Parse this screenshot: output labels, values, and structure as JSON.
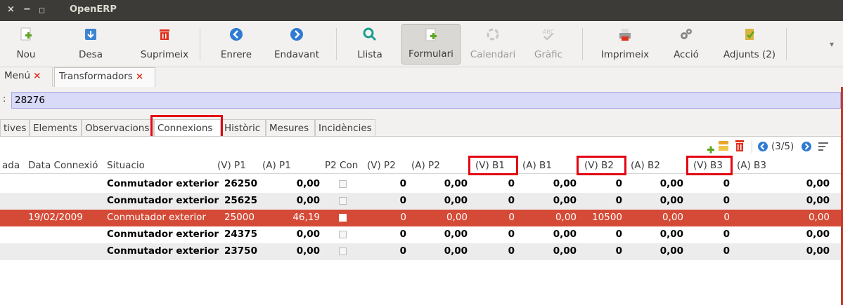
{
  "window": {
    "title": "OpenERP",
    "controls": [
      "×",
      "−",
      "◻"
    ]
  },
  "toolbar": {
    "buttons": [
      {
        "label": "Nou",
        "icon": "new-document-icon",
        "enabled": true
      },
      {
        "label": "Desa",
        "icon": "save-icon",
        "enabled": true
      },
      {
        "label": "Suprimeix",
        "icon": "trash-icon",
        "enabled": true
      },
      {
        "label": "Enrere",
        "icon": "arrow-left-icon",
        "enabled": true
      },
      {
        "label": "Endavant",
        "icon": "arrow-right-icon",
        "enabled": true
      },
      {
        "label": "Llista",
        "icon": "search-icon",
        "enabled": true
      },
      {
        "label": "Formulari",
        "icon": "form-icon",
        "enabled": true,
        "active": true
      },
      {
        "label": "Calendari",
        "icon": "calendar-icon",
        "enabled": false
      },
      {
        "label": "Gràfic",
        "icon": "graph-icon",
        "enabled": false
      },
      {
        "label": "Imprimeix",
        "icon": "print-icon",
        "enabled": true
      },
      {
        "label": "Acció",
        "icon": "gears-icon",
        "enabled": true
      },
      {
        "label": "Adjunts (2)",
        "icon": "attachment-icon",
        "enabled": true
      }
    ],
    "overflow": "▾"
  },
  "doc_tabs": [
    {
      "label": "Menú",
      "close": "×"
    },
    {
      "label": "Transformadors",
      "close": "×",
      "active": true
    }
  ],
  "record": {
    "colon": ":",
    "id_value": "28276"
  },
  "form_tabs": [
    {
      "label": "tives"
    },
    {
      "label": "Elements"
    },
    {
      "label": "Observacions"
    },
    {
      "label": "Connexions",
      "active": true
    },
    {
      "label": "Històric"
    },
    {
      "label": "Mesures"
    },
    {
      "label": "Incidències"
    }
  ],
  "list": {
    "pager": "(3/5)",
    "columns": [
      "ada",
      "Data Connexió",
      "Situacio",
      "(V) P1",
      "(A) P1",
      "P2 Con",
      "(V) P2",
      "(A) P2",
      "(V) B1",
      "(A) B1",
      "(V) B2",
      "(A) B2",
      "(V) B3",
      "(A) B3"
    ],
    "rows": [
      {
        "date": "",
        "situacio": "Conmutador exterior",
        "v_p1": "26250",
        "a_p1": "0,00",
        "p2con": false,
        "v_p2": "0",
        "a_p2": "0,00",
        "v_b1": "0",
        "a_b1": "0,00",
        "v_b2": "0",
        "a_b2": "0,00",
        "v_b3": "0",
        "a_b3": "0,00"
      },
      {
        "date": "",
        "situacio": "Conmutador exterior",
        "v_p1": "25625",
        "a_p1": "0,00",
        "p2con": false,
        "v_p2": "0",
        "a_p2": "0,00",
        "v_b1": "0",
        "a_b1": "0,00",
        "v_b2": "0",
        "a_b2": "0,00",
        "v_b3": "0",
        "a_b3": "0,00"
      },
      {
        "date": "19/02/2009",
        "situacio": "Conmutador exterior",
        "v_p1": "25000",
        "a_p1": "46,19",
        "p2con": true,
        "v_p2": "0",
        "a_p2": "0,00",
        "v_b1": "0",
        "a_b1": "0,00",
        "v_b2": "10500",
        "a_b2": "0,00",
        "v_b3": "0",
        "a_b3": "0,00",
        "selected": true
      },
      {
        "date": "",
        "situacio": "Conmutador exterior",
        "v_p1": "24375",
        "a_p1": "0,00",
        "p2con": false,
        "v_p2": "0",
        "a_p2": "0,00",
        "v_b1": "0",
        "a_b1": "0,00",
        "v_b2": "0",
        "a_b2": "0,00",
        "v_b3": "0",
        "a_b3": "0,00"
      },
      {
        "date": "",
        "situacio": "Conmutador exterior",
        "v_p1": "23750",
        "a_p1": "0,00",
        "p2con": false,
        "v_p2": "0",
        "a_p2": "0,00",
        "v_b1": "0",
        "a_b1": "0,00",
        "v_b2": "0",
        "a_b2": "0,00",
        "v_b3": "0",
        "a_b3": "0,00"
      }
    ]
  },
  "colors": {
    "titlebar": "#3c3b37",
    "selected_row": "#d54a36",
    "highlight_box": "#e30613",
    "id_field": "#d9d9f8"
  }
}
